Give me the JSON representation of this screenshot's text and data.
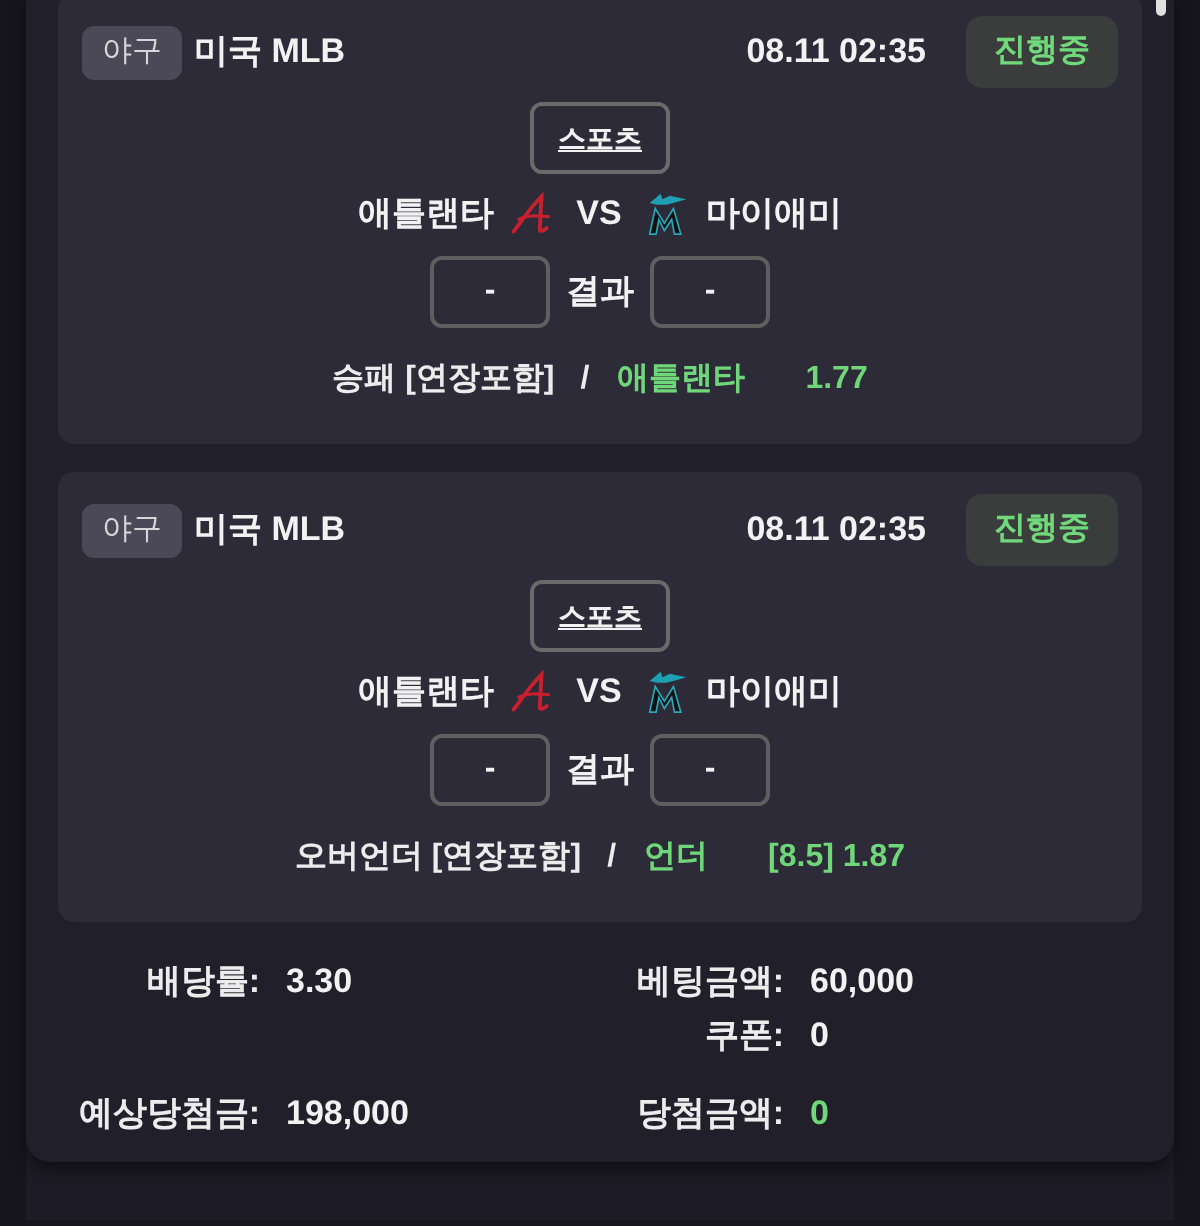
{
  "bets": [
    {
      "sport": "야구",
      "league": "미국 MLB",
      "datetime": "08.11 02:35",
      "status": "진행중",
      "category": "스포츠",
      "home": "애틀랜타",
      "vs": "VS",
      "away": "마이애미",
      "home_score": "-",
      "result_label": "결과",
      "away_score": "-",
      "market": "승패 [연장포함]",
      "separator": "/",
      "pick": "애틀랜타",
      "odds": "1.77"
    },
    {
      "sport": "야구",
      "league": "미국 MLB",
      "datetime": "08.11 02:35",
      "status": "진행중",
      "category": "스포츠",
      "home": "애틀랜타",
      "vs": "VS",
      "away": "마이애미",
      "home_score": "-",
      "result_label": "결과",
      "away_score": "-",
      "market": "오버언더 [연장포함]",
      "separator": "/",
      "pick": "언더",
      "odds": "[8.5] 1.87"
    }
  ],
  "summary": {
    "groups": [
      {
        "rows": [
          {
            "left": {
              "label": "배당률:",
              "value": "3.30",
              "highlight": false
            },
            "right": {
              "label": "베팅금액:",
              "value": "60,000",
              "highlight": false
            }
          },
          {
            "right": {
              "label": "쿠폰:",
              "value": "0",
              "highlight": false
            }
          }
        ]
      },
      {
        "rows": [
          {
            "left": {
              "label": "예상당첨금:",
              "value": "198,000",
              "highlight": false
            },
            "right": {
              "label": "당첨금액:",
              "value": "0",
              "highlight": true
            }
          }
        ]
      }
    ]
  }
}
